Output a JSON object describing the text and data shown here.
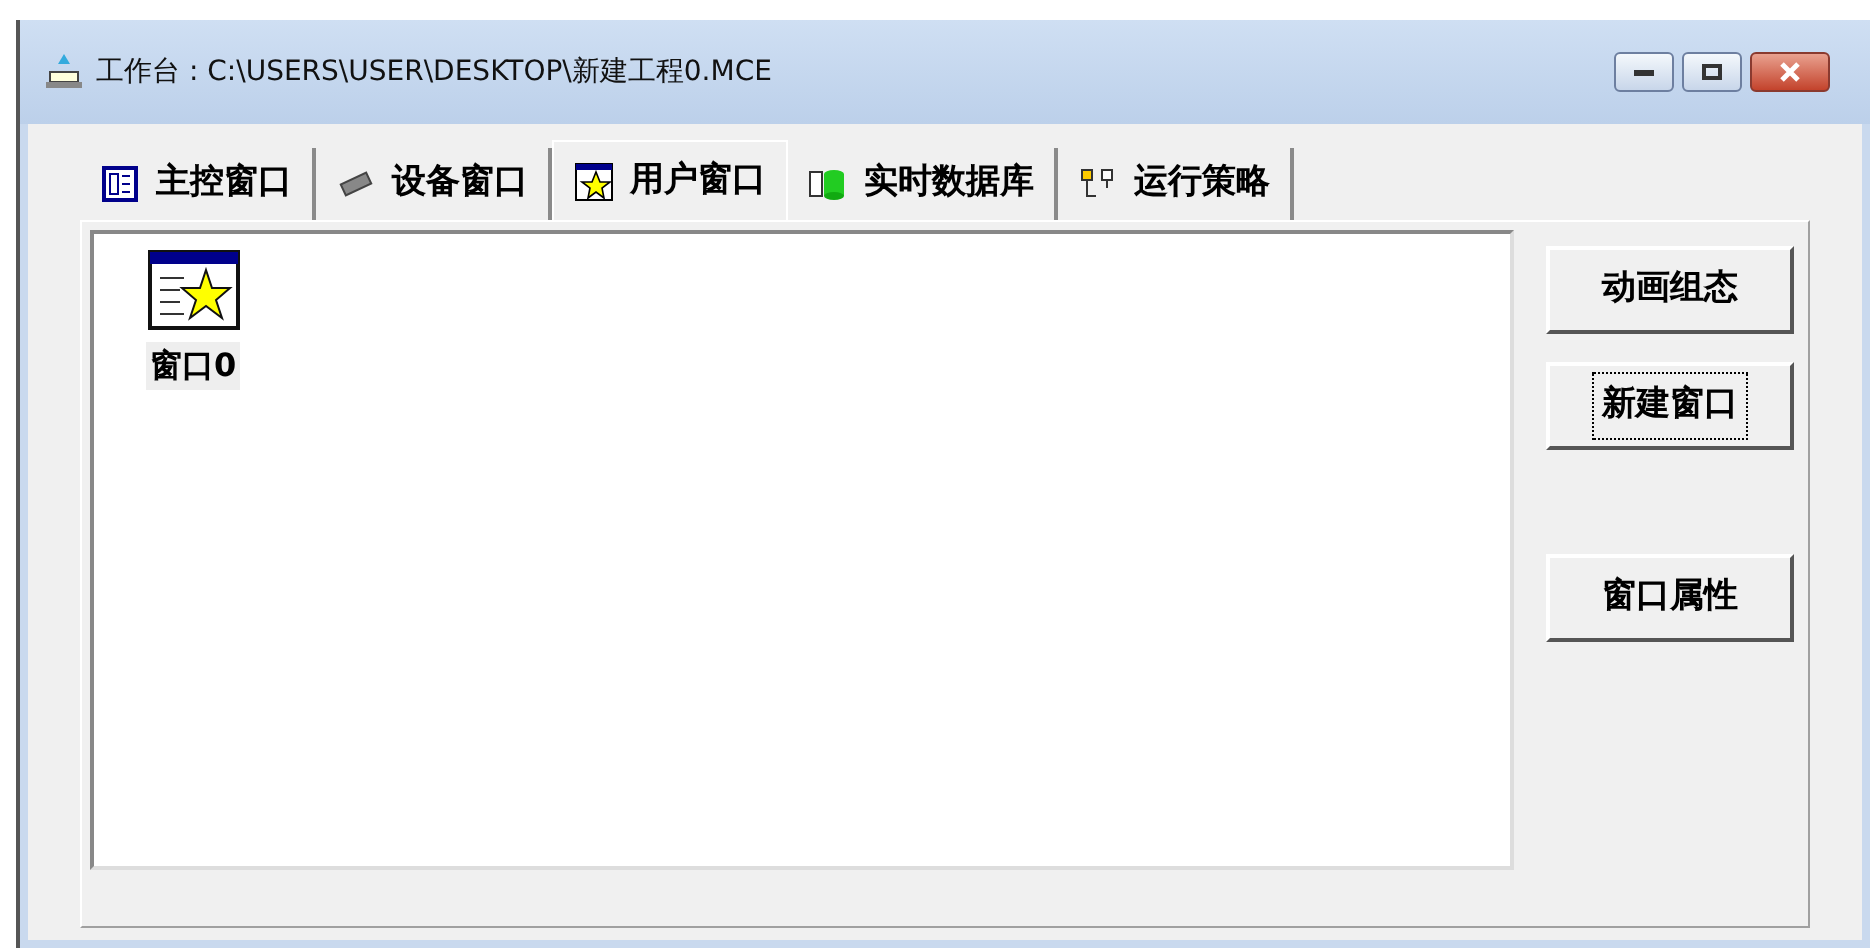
{
  "window": {
    "title": "工作台 : C:\\USERS\\USER\\DESKTOP\\新建工程0.MCE"
  },
  "tabs": [
    {
      "label": "主控窗口",
      "selected": false
    },
    {
      "label": "设备窗口",
      "selected": false
    },
    {
      "label": "用户窗口",
      "selected": true
    },
    {
      "label": "实时数据库",
      "selected": false
    },
    {
      "label": "运行策略",
      "selected": false
    }
  ],
  "items": [
    {
      "label": "窗口0"
    }
  ],
  "buttons": [
    {
      "label": "动画组态",
      "focused": false
    },
    {
      "label": "新建窗口",
      "focused": true
    },
    {
      "label": "窗口属性",
      "focused": false
    }
  ]
}
